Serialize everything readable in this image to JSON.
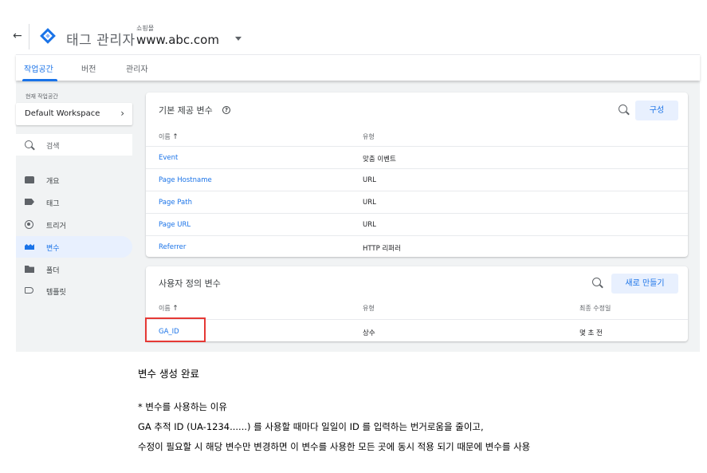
{
  "header": {
    "back_symbol": "←",
    "app_title": "태그 관리자",
    "container_account": "쇼핑몰",
    "container_name": "www.abc.com"
  },
  "tabs": [
    {
      "label": "작업공간",
      "active": true
    },
    {
      "label": "버전",
      "active": false
    },
    {
      "label": "관리자",
      "active": false
    }
  ],
  "sidebar": {
    "workspace_label": "현재 작업공간",
    "workspace_name": "Default Workspace",
    "search_placeholder": "검색",
    "items": [
      {
        "label": "개요",
        "icon": "overview-icon",
        "active": false
      },
      {
        "label": "태그",
        "icon": "tag-icon",
        "active": false
      },
      {
        "label": "트리거",
        "icon": "trigger-icon",
        "active": false
      },
      {
        "label": "변수",
        "icon": "variable-icon",
        "active": true
      },
      {
        "label": "폴더",
        "icon": "folder-icon",
        "active": false
      },
      {
        "label": "템플릿",
        "icon": "template-icon",
        "active": false
      }
    ]
  },
  "builtin_vars": {
    "title": "기본 제공 변수",
    "configure_label": "구성",
    "col_name": "이름",
    "col_type": "유형",
    "rows": [
      {
        "name": "Event",
        "type": "맞춤 이벤트"
      },
      {
        "name": "Page Hostname",
        "type": "URL"
      },
      {
        "name": "Page Path",
        "type": "URL"
      },
      {
        "name": "Page URL",
        "type": "URL"
      },
      {
        "name": "Referrer",
        "type": "HTTP 리퍼러"
      }
    ]
  },
  "user_vars": {
    "title": "사용자 정의 변수",
    "new_label": "새로 만들기",
    "col_name": "이름",
    "col_type": "유형",
    "col_edited": "최종 수정일",
    "rows": [
      {
        "name": "GA_ID",
        "type": "상수",
        "edited": "몇 초 전"
      }
    ]
  },
  "article": {
    "heading": "변수 생성 완료",
    "line1": "* 변수를 사용하는 이유",
    "line2": "GA 추적 ID (UA-1234......) 를 사용할 때마다 일일이 ID 를 입력하는 번거로움을 줄이고,",
    "line3": "수정이 필요할 시 해당 변수만 변경하면 이 변수를 사용한 모든 곳에 동시 적용 되기 때문에 변수를 사용"
  },
  "colors": {
    "accent": "#1a73e8",
    "highlight": "#e53935",
    "background": "#f1f3f4"
  }
}
